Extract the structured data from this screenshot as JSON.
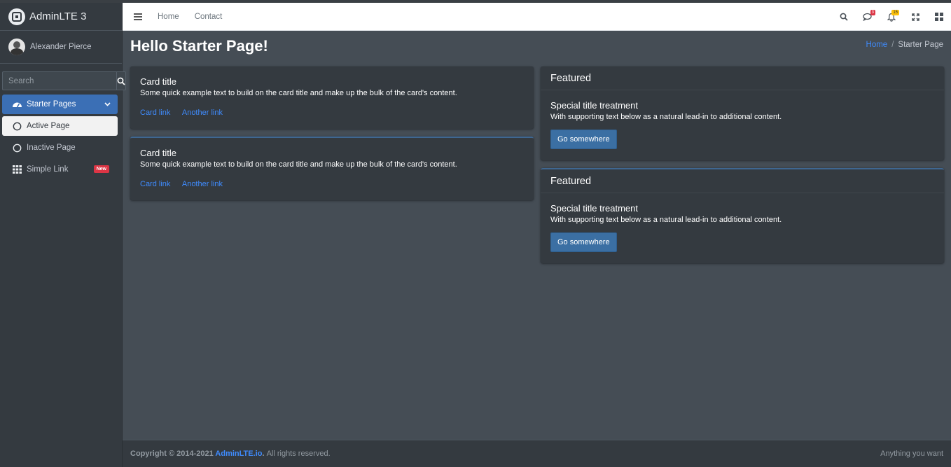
{
  "sidebar": {
    "brand": "AdminLTE 3",
    "user": "Alexander Pierce",
    "search_placeholder": "Search",
    "items": [
      {
        "label": "Starter Pages"
      },
      {
        "label": "Active Page"
      },
      {
        "label": "Inactive Page"
      },
      {
        "label": "Simple Link",
        "badge": "New"
      }
    ]
  },
  "navbar": {
    "links": [
      "Home",
      "Contact"
    ],
    "messages_badge": "3",
    "notifications_badge": "15"
  },
  "page": {
    "title": "Hello Starter Page!",
    "breadcrumb": [
      "Home",
      "Starter Page"
    ]
  },
  "cards_left": [
    {
      "title": "Card title",
      "text": "Some quick example text to build on the card title and make up the bulk of the card's content.",
      "links": [
        "Card link",
        "Another link"
      ]
    },
    {
      "title": "Card title",
      "text": "Some quick example text to build on the card title and make up the bulk of the card's content.",
      "links": [
        "Card link",
        "Another link"
      ]
    }
  ],
  "cards_right": [
    {
      "header": "Featured",
      "title": "Special title treatment",
      "text": "With supporting text below as a natural lead-in to additional content.",
      "button": "Go somewhere"
    },
    {
      "header": "Featured",
      "title": "Special title treatment",
      "text": "With supporting text below as a natural lead-in to additional content.",
      "button": "Go somewhere"
    }
  ],
  "footer": {
    "copyright": "Copyright © 2014-2021",
    "link": "AdminLTE.io",
    "period": ".",
    "rights": "All rights reserved.",
    "right_text": "Anything you want"
  },
  "colors": {
    "sidebar_bg": "#343a40",
    "content_bg": "#454d55",
    "accent": "#3b6fb5",
    "link": "#3f8cff",
    "badge_red": "#dc3545",
    "badge_yellow": "#ffc107"
  },
  "icons": [
    "brand-logo-icon",
    "search-icon",
    "tachometer-icon",
    "chevron-down-icon",
    "circle-icon",
    "th-icon",
    "bars-icon",
    "comments-icon",
    "bell-icon",
    "expand-icon",
    "grid-icon"
  ]
}
